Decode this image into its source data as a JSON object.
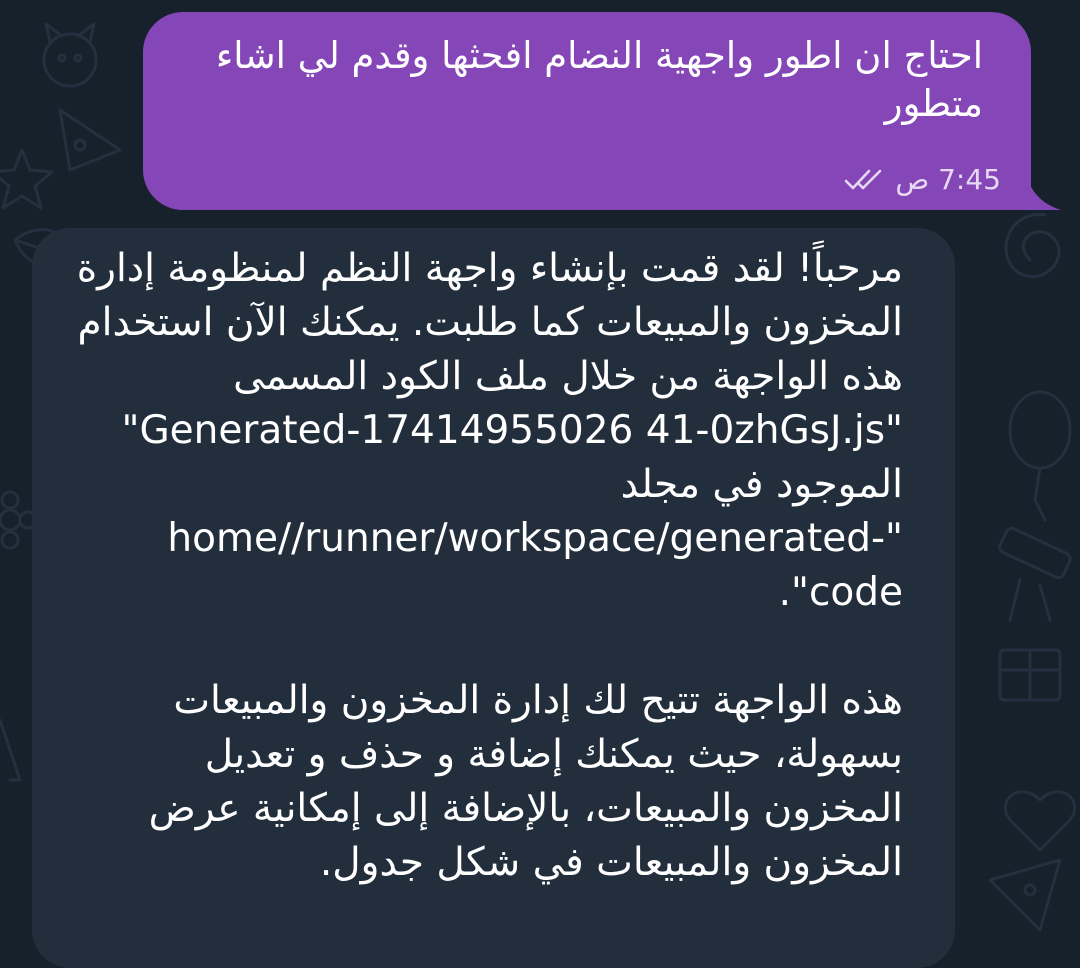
{
  "chat": {
    "outgoing": {
      "text": "احتاج ان اطور واجهية النضام افحثها وقدم لي اشاء متطور",
      "time": "7:45 ص",
      "status_icon": "double-check-icon",
      "bubble_color": "#8547b8"
    },
    "incoming": {
      "paragraph_1": "مرحباً! لقد قمت بإنشاء واجهة النظم لمنظومة إدارة المخزون والمبيعات كما طلبت. يمكنك الآن استخدام هذه الواجهة من خلال ملف الكود المسمى \"Generated-17414955026 41-0zhGsJ.js\" الموجود في مجلد \"home//runner/workspace/generated-code\".",
      "paragraph_2": "هذه الواجهة تتيح لك إدارة المخزون والمبيعات بسهولة، حيث يمكنك إضافة و حذف و تعديل المخزون والمبيعات، بالإضافة إلى إمكانية عرض المخزون والمبيعات في شكل جدول.",
      "bubble_color": "#232e3c"
    },
    "background_color": "#17212b"
  }
}
